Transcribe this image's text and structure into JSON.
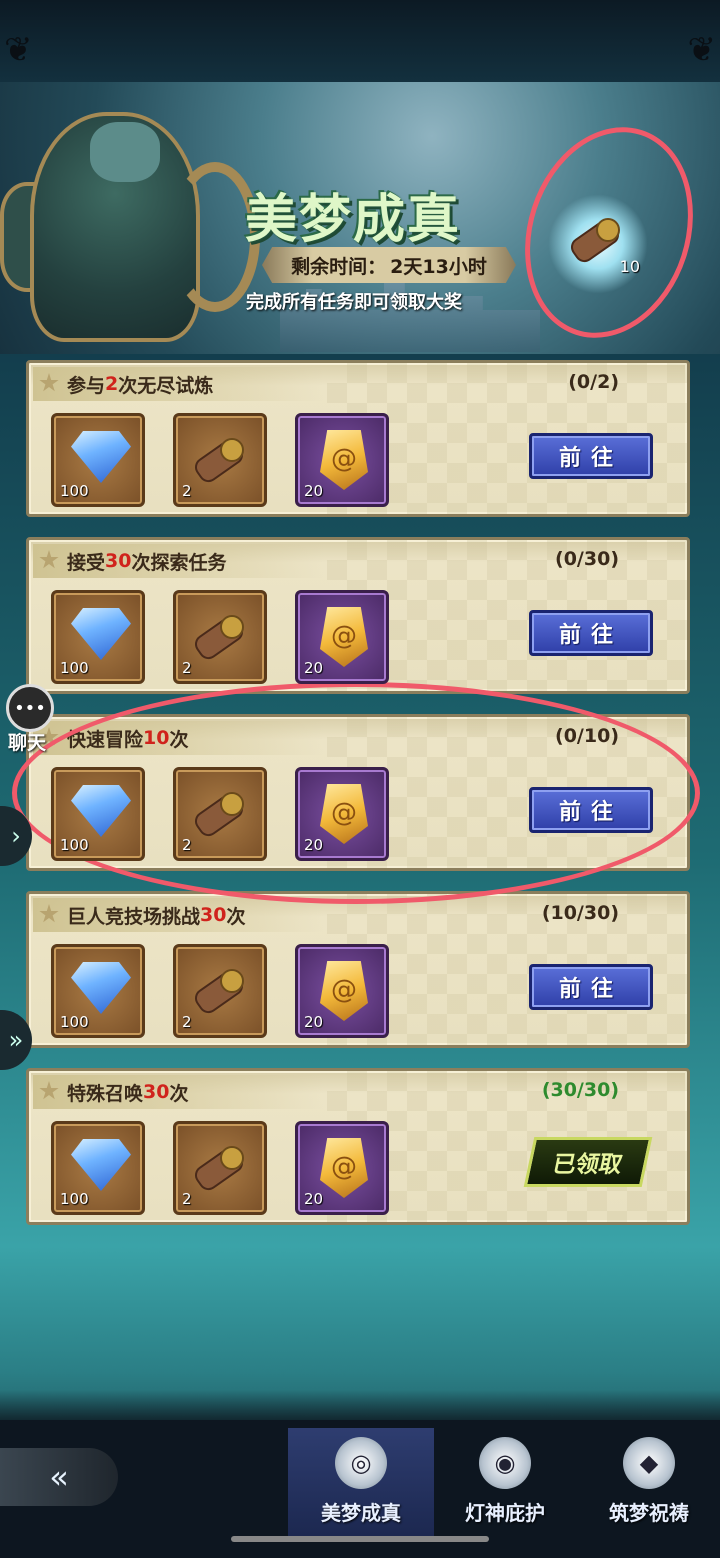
{
  "banner": {
    "title": "美梦成真",
    "time_label": "剩余时间：",
    "time_value": "2天13小时",
    "description": "完成所有任务即可领取大奖",
    "grand_prize_count": "10"
  },
  "tasks": [
    {
      "prefix": "参与",
      "count": "2",
      "suffix": "次无尽试炼",
      "progress": "(0/2)",
      "status": "go",
      "button": "前往",
      "rewards": [
        {
          "type": "diamond",
          "qty": "100"
        },
        {
          "type": "scroll",
          "qty": "2"
        },
        {
          "type": "rune",
          "qty": "20"
        }
      ]
    },
    {
      "prefix": "接受",
      "count": "30",
      "suffix": "次探索任务",
      "progress": "(0/30)",
      "status": "go",
      "button": "前往",
      "rewards": [
        {
          "type": "diamond",
          "qty": "100"
        },
        {
          "type": "scroll",
          "qty": "2"
        },
        {
          "type": "rune",
          "qty": "20"
        }
      ]
    },
    {
      "prefix": "快速冒险",
      "count": "10",
      "suffix": "次",
      "progress": "(0/10)",
      "status": "go",
      "button": "前往",
      "rewards": [
        {
          "type": "diamond",
          "qty": "100"
        },
        {
          "type": "scroll",
          "qty": "2"
        },
        {
          "type": "rune",
          "qty": "20"
        }
      ]
    },
    {
      "prefix": "巨人竞技场挑战",
      "count": "30",
      "suffix": "次",
      "progress": "(10/30)",
      "status": "go",
      "button": "前往",
      "rewards": [
        {
          "type": "diamond",
          "qty": "100"
        },
        {
          "type": "scroll",
          "qty": "2"
        },
        {
          "type": "rune",
          "qty": "20"
        }
      ]
    },
    {
      "prefix": "特殊召唤",
      "count": "30",
      "suffix": "次",
      "progress": "(30/30)",
      "status": "claimed",
      "button": "已领取",
      "rewards": [
        {
          "type": "diamond",
          "qty": "100"
        },
        {
          "type": "scroll",
          "qty": "2"
        },
        {
          "type": "rune",
          "qty": "20"
        }
      ]
    }
  ],
  "side": {
    "chat_label": "聊天"
  },
  "nav": {
    "tabs": [
      {
        "label": "美梦成真",
        "icon": "dream-icon",
        "active": true
      },
      {
        "label": "灯神庇护",
        "icon": "lamp-genie-icon",
        "active": false
      },
      {
        "label": "筑梦祝祷",
        "icon": "crystal-icon",
        "active": false
      }
    ]
  },
  "colors": {
    "count_highlight": "#d0231c",
    "progress_done": "#2e8b2e",
    "annotation": "#f05a6a"
  }
}
